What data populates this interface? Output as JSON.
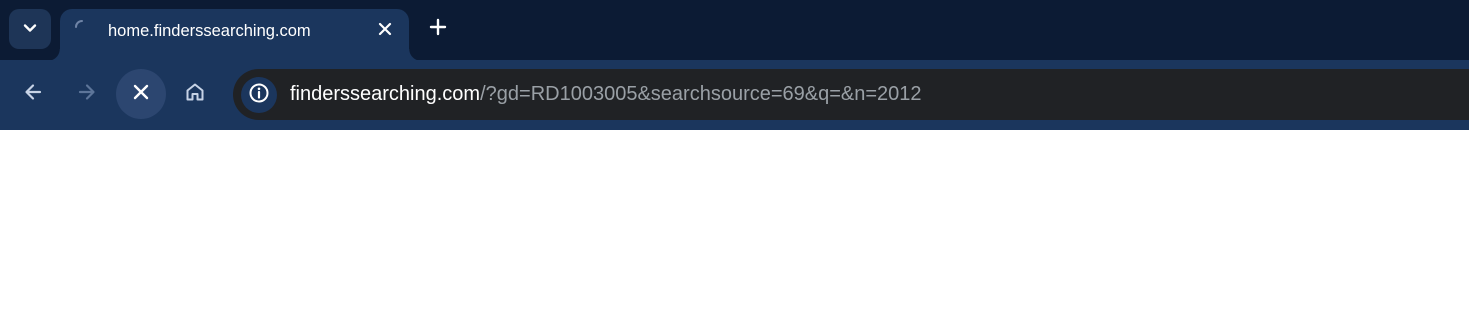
{
  "tabstrip": {
    "active_tab": {
      "title": "home.finderssearching.com",
      "loading": true
    }
  },
  "toolbar": {
    "omnibox": {
      "host": "finderssearching.com",
      "path": "/?gd=RD1003005&searchsource=69&q=&n=2012"
    }
  },
  "colors": {
    "tabstrip_bg": "#0c1b34",
    "toolbar_bg": "#1b365d",
    "omnibox_bg": "#202225",
    "url_host": "#ffffff",
    "url_path": "#9aa0a6"
  },
  "icons": {
    "tab_search": "chevron-down-icon",
    "tab_loading": "spinner-icon",
    "tab_close": "close-icon",
    "new_tab": "plus-icon",
    "back": "arrow-left-icon",
    "forward": "arrow-right-icon",
    "stop": "close-icon",
    "home": "home-icon",
    "site_info": "info-icon"
  }
}
